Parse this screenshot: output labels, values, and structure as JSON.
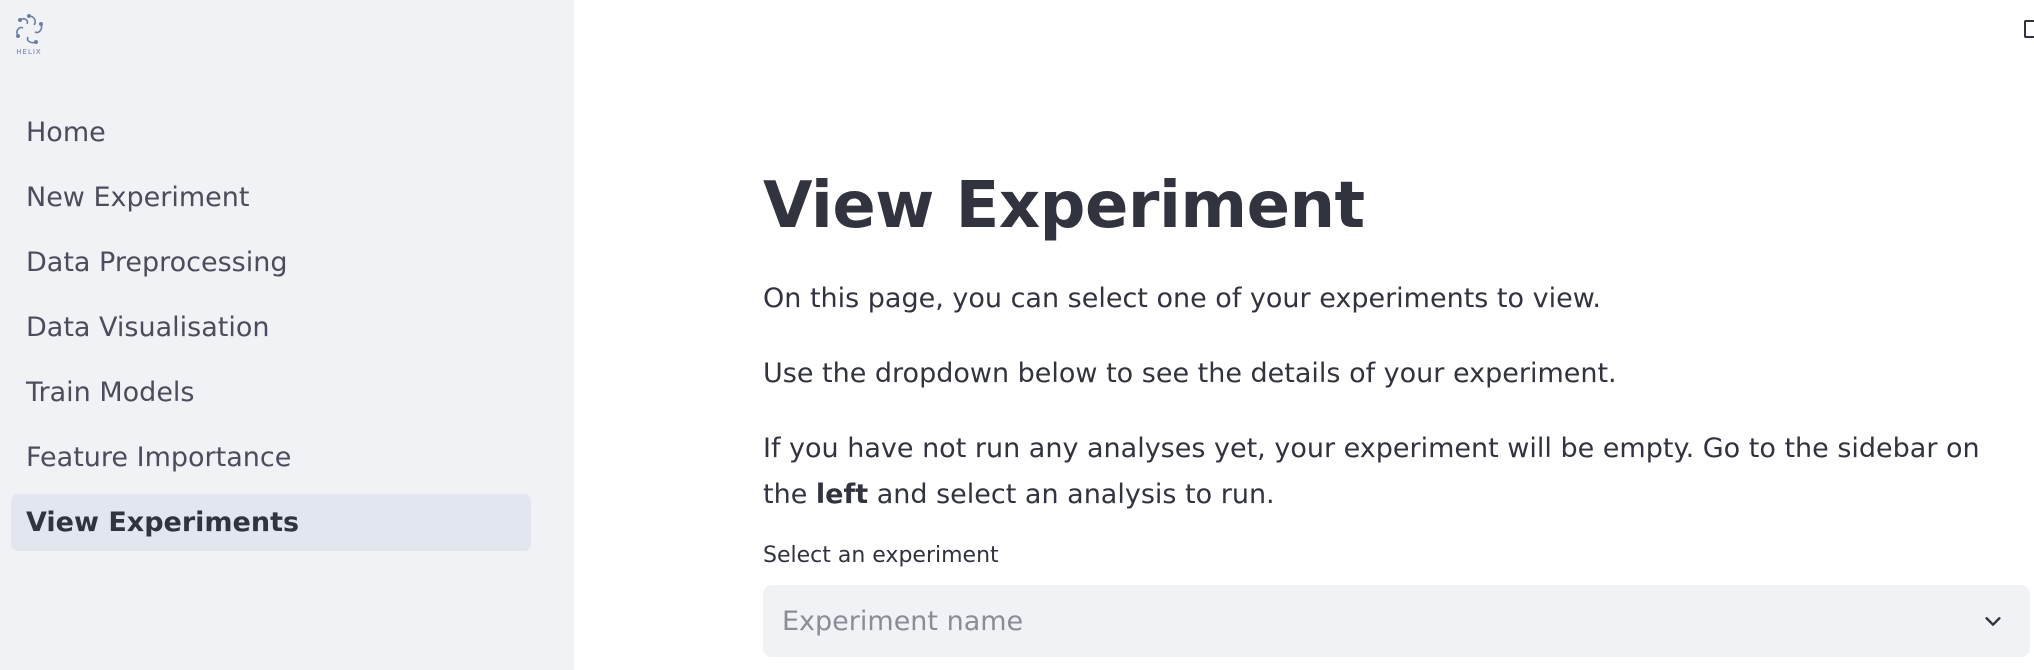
{
  "sidebar": {
    "logo_text": "HELIX",
    "items": [
      {
        "label": "Home",
        "active": false
      },
      {
        "label": "New Experiment",
        "active": false
      },
      {
        "label": "Data Preprocessing",
        "active": false
      },
      {
        "label": "Data Visualisation",
        "active": false
      },
      {
        "label": "Train Models",
        "active": false
      },
      {
        "label": "Feature Importance",
        "active": false
      },
      {
        "label": "View Experiments",
        "active": true
      }
    ]
  },
  "main": {
    "title": "View Experiment",
    "paragraph1": "On this page, you can select one of your experiments to view.",
    "paragraph2": "Use the dropdown below to see the details of your experiment.",
    "paragraph3_before": "If you have not run any analyses yet, your experiment will be empty. Go to the sidebar on the ",
    "paragraph3_bold": "left",
    "paragraph3_after": " and select an analysis to run.",
    "select_label": "Select an experiment",
    "select_placeholder": "Experiment name"
  },
  "icons": {
    "logo": "helix-logo-icon",
    "dropdown": "chevron-down-icon",
    "top_right": "deploy-icon"
  },
  "colors": {
    "sidebar_bg": "#f0f2f6",
    "active_item_bg": "#e2e6ee",
    "text": "#31333f",
    "placeholder": "#8a8d96",
    "logo": "#6b7fa8"
  }
}
